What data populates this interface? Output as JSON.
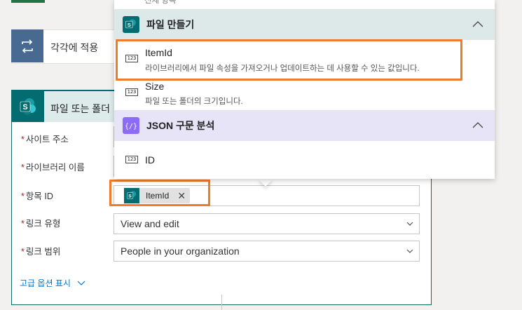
{
  "apply_each": {
    "label": "각각에 적용"
  },
  "card": {
    "title": "파일 또는 폴더",
    "fields": [
      {
        "label": "사이트 주소"
      },
      {
        "label": "라이브러리 이름"
      },
      {
        "label": "항목 ID",
        "token": "ItemId"
      },
      {
        "label": "링크 유형",
        "value": "View and edit"
      },
      {
        "label": "링크 범위",
        "value": "People in your organization"
      }
    ],
    "required_mark": "*",
    "advanced": "고급 옵션 표시"
  },
  "panel": {
    "top_cut_text": "전체 항목",
    "sections": [
      {
        "title": "파일 만들기",
        "color": "#036c70",
        "header_bg": "#dde9e8",
        "items": [
          {
            "icon": "number-icon",
            "title": "ItemId",
            "desc": "라이브러리에서 파일 속성을 가져오거나 업데이트하는 데 사용할 수 있는 값입니다."
          },
          {
            "icon": "number-icon",
            "title": "Size",
            "desc": "파일 또는 폴더의 크기입니다."
          }
        ]
      },
      {
        "title": "JSON 구문 분석",
        "color": "#8c6cf7",
        "header_bg": "#e8e4f7",
        "items": [
          {
            "icon": "number-icon",
            "title": "ID",
            "desc": ""
          }
        ]
      }
    ],
    "number_glyph": "123"
  },
  "colors": {
    "highlight": "#f07b2c",
    "sharepoint": "#036c70",
    "link": "#0078d4"
  }
}
